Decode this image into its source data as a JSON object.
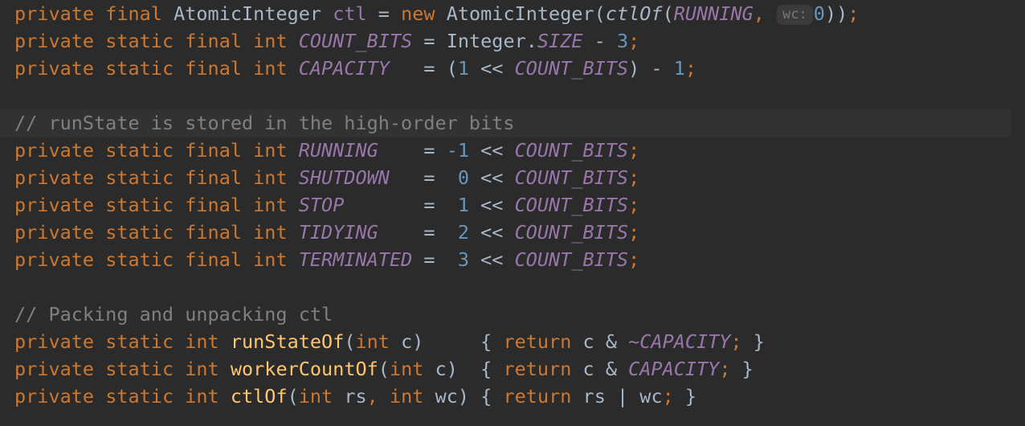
{
  "editor": {
    "language": "java",
    "theme": "darcula",
    "background_color": "#2b2b2b",
    "caret_line_color": "#323232",
    "font_size_px": 23.5,
    "line_height_px": 34,
    "colors": {
      "keyword": "#cc7832",
      "number": "#6897bb",
      "constant": "#9876aa",
      "field": "#9876aa",
      "method_declaration": "#ffc66d",
      "method_call": "#a9b7c6",
      "comment": "#808080",
      "identifier": "#a9b7c6",
      "semicolon": "#cc7832",
      "param_hint_text": "#787878",
      "param_hint_background": "#3b3b3b"
    },
    "caret_line_index": 4
  },
  "param_hints": [
    {
      "label": "wc:",
      "on_line": 1,
      "before_value": "0"
    }
  ],
  "lines": [
    {
      "n": 1,
      "caret": false,
      "text": "    private final AtomicInteger ctl = new AtomicInteger(ctlOf(RUNNING,  wc: 0));",
      "tokens": [
        {
          "t": "private",
          "c": "tok-kw"
        },
        {
          "t": " ",
          "c": "tok-punct"
        },
        {
          "t": "final",
          "c": "tok-kw"
        },
        {
          "t": " ",
          "c": "tok-punct"
        },
        {
          "t": "AtomicInteger",
          "c": "tok-type"
        },
        {
          "t": " ",
          "c": "tok-punct"
        },
        {
          "t": "ctl",
          "c": "tok-field"
        },
        {
          "t": " = ",
          "c": "tok-op"
        },
        {
          "t": "new",
          "c": "tok-kw"
        },
        {
          "t": " ",
          "c": "tok-punct"
        },
        {
          "t": "AtomicInteger",
          "c": "tok-type"
        },
        {
          "t": "(",
          "c": "tok-punct"
        },
        {
          "t": "ctlOf",
          "c": "tok-call"
        },
        {
          "t": "(",
          "c": "tok-punct"
        },
        {
          "t": "RUNNING",
          "c": "tok-const"
        },
        {
          "t": ",",
          "c": "tok-semi"
        },
        {
          "t": " ",
          "c": "tok-punct"
        },
        {
          "t": "wc:",
          "c": "param-hint"
        },
        {
          "t": "0",
          "c": "tok-num"
        },
        {
          "t": "))",
          "c": "tok-punct"
        },
        {
          "t": ";",
          "c": "tok-semi"
        }
      ]
    },
    {
      "n": 2,
      "caret": false,
      "text": "    private static final int COUNT_BITS = Integer.SIZE - 3;",
      "tokens": [
        {
          "t": "private",
          "c": "tok-kw"
        },
        {
          "t": " ",
          "c": "tok-punct"
        },
        {
          "t": "static",
          "c": "tok-kw"
        },
        {
          "t": " ",
          "c": "tok-punct"
        },
        {
          "t": "final",
          "c": "tok-kw"
        },
        {
          "t": " ",
          "c": "tok-punct"
        },
        {
          "t": "int",
          "c": "tok-kw"
        },
        {
          "t": " ",
          "c": "tok-punct"
        },
        {
          "t": "COUNT_BITS",
          "c": "tok-const"
        },
        {
          "t": " = ",
          "c": "tok-op"
        },
        {
          "t": "Integer",
          "c": "tok-type"
        },
        {
          "t": ".",
          "c": "tok-punct"
        },
        {
          "t": "SIZE",
          "c": "tok-const"
        },
        {
          "t": " - ",
          "c": "tok-op"
        },
        {
          "t": "3",
          "c": "tok-num"
        },
        {
          "t": ";",
          "c": "tok-semi"
        }
      ]
    },
    {
      "n": 3,
      "caret": false,
      "text": "    private static final int CAPACITY   = (1 << COUNT_BITS) - 1;",
      "tokens": [
        {
          "t": "private",
          "c": "tok-kw"
        },
        {
          "t": " ",
          "c": "tok-punct"
        },
        {
          "t": "static",
          "c": "tok-kw"
        },
        {
          "t": " ",
          "c": "tok-punct"
        },
        {
          "t": "final",
          "c": "tok-kw"
        },
        {
          "t": " ",
          "c": "tok-punct"
        },
        {
          "t": "int",
          "c": "tok-kw"
        },
        {
          "t": " ",
          "c": "tok-punct"
        },
        {
          "t": "CAPACITY",
          "c": "tok-const"
        },
        {
          "t": "   = ",
          "c": "tok-op"
        },
        {
          "t": "(",
          "c": "tok-punct"
        },
        {
          "t": "1",
          "c": "tok-num"
        },
        {
          "t": " << ",
          "c": "tok-op"
        },
        {
          "t": "COUNT_BITS",
          "c": "tok-const"
        },
        {
          "t": ")",
          "c": "tok-punct"
        },
        {
          "t": " - ",
          "c": "tok-op"
        },
        {
          "t": "1",
          "c": "tok-num"
        },
        {
          "t": ";",
          "c": "tok-semi"
        }
      ]
    },
    {
      "n": 4,
      "caret": false,
      "blank": true,
      "text": "",
      "tokens": []
    },
    {
      "n": 5,
      "caret": true,
      "text": "    // runState is stored in the high-order bits",
      "tokens": [
        {
          "t": "// runState is stored in the high-order bits",
          "c": "tok-comment"
        }
      ]
    },
    {
      "n": 6,
      "caret": false,
      "text": "    private static final int RUNNING    = -1 << COUNT_BITS;",
      "tokens": [
        {
          "t": "private",
          "c": "tok-kw"
        },
        {
          "t": " ",
          "c": "tok-punct"
        },
        {
          "t": "static",
          "c": "tok-kw"
        },
        {
          "t": " ",
          "c": "tok-punct"
        },
        {
          "t": "final",
          "c": "tok-kw"
        },
        {
          "t": " ",
          "c": "tok-punct"
        },
        {
          "t": "int",
          "c": "tok-kw"
        },
        {
          "t": " ",
          "c": "tok-punct"
        },
        {
          "t": "RUNNING",
          "c": "tok-const"
        },
        {
          "t": "    = ",
          "c": "tok-op"
        },
        {
          "t": "-1",
          "c": "tok-num"
        },
        {
          "t": " << ",
          "c": "tok-op"
        },
        {
          "t": "COUNT_BITS",
          "c": "tok-const"
        },
        {
          "t": ";",
          "c": "tok-semi"
        }
      ]
    },
    {
      "n": 7,
      "caret": false,
      "text": "    private static final int SHUTDOWN   =  0 << COUNT_BITS;",
      "tokens": [
        {
          "t": "private",
          "c": "tok-kw"
        },
        {
          "t": " ",
          "c": "tok-punct"
        },
        {
          "t": "static",
          "c": "tok-kw"
        },
        {
          "t": " ",
          "c": "tok-punct"
        },
        {
          "t": "final",
          "c": "tok-kw"
        },
        {
          "t": " ",
          "c": "tok-punct"
        },
        {
          "t": "int",
          "c": "tok-kw"
        },
        {
          "t": " ",
          "c": "tok-punct"
        },
        {
          "t": "SHUTDOWN",
          "c": "tok-const"
        },
        {
          "t": "   =  ",
          "c": "tok-op"
        },
        {
          "t": "0",
          "c": "tok-num"
        },
        {
          "t": " << ",
          "c": "tok-op"
        },
        {
          "t": "COUNT_BITS",
          "c": "tok-const"
        },
        {
          "t": ";",
          "c": "tok-semi"
        }
      ]
    },
    {
      "n": 8,
      "caret": false,
      "text": "    private static final int STOP       =  1 << COUNT_BITS;",
      "tokens": [
        {
          "t": "private",
          "c": "tok-kw"
        },
        {
          "t": " ",
          "c": "tok-punct"
        },
        {
          "t": "static",
          "c": "tok-kw"
        },
        {
          "t": " ",
          "c": "tok-punct"
        },
        {
          "t": "final",
          "c": "tok-kw"
        },
        {
          "t": " ",
          "c": "tok-punct"
        },
        {
          "t": "int",
          "c": "tok-kw"
        },
        {
          "t": " ",
          "c": "tok-punct"
        },
        {
          "t": "STOP",
          "c": "tok-const"
        },
        {
          "t": "       =  ",
          "c": "tok-op"
        },
        {
          "t": "1",
          "c": "tok-num"
        },
        {
          "t": " << ",
          "c": "tok-op"
        },
        {
          "t": "COUNT_BITS",
          "c": "tok-const"
        },
        {
          "t": ";",
          "c": "tok-semi"
        }
      ]
    },
    {
      "n": 9,
      "caret": false,
      "text": "    private static final int TIDYING    =  2 << COUNT_BITS;",
      "tokens": [
        {
          "t": "private",
          "c": "tok-kw"
        },
        {
          "t": " ",
          "c": "tok-punct"
        },
        {
          "t": "static",
          "c": "tok-kw"
        },
        {
          "t": " ",
          "c": "tok-punct"
        },
        {
          "t": "final",
          "c": "tok-kw"
        },
        {
          "t": " ",
          "c": "tok-punct"
        },
        {
          "t": "int",
          "c": "tok-kw"
        },
        {
          "t": " ",
          "c": "tok-punct"
        },
        {
          "t": "TIDYING",
          "c": "tok-const"
        },
        {
          "t": "    =  ",
          "c": "tok-op"
        },
        {
          "t": "2",
          "c": "tok-num"
        },
        {
          "t": " << ",
          "c": "tok-op"
        },
        {
          "t": "COUNT_BITS",
          "c": "tok-const"
        },
        {
          "t": ";",
          "c": "tok-semi"
        }
      ]
    },
    {
      "n": 10,
      "caret": false,
      "text": "    private static final int TERMINATED =  3 << COUNT_BITS;",
      "tokens": [
        {
          "t": "private",
          "c": "tok-kw"
        },
        {
          "t": " ",
          "c": "tok-punct"
        },
        {
          "t": "static",
          "c": "tok-kw"
        },
        {
          "t": " ",
          "c": "tok-punct"
        },
        {
          "t": "final",
          "c": "tok-kw"
        },
        {
          "t": " ",
          "c": "tok-punct"
        },
        {
          "t": "int",
          "c": "tok-kw"
        },
        {
          "t": " ",
          "c": "tok-punct"
        },
        {
          "t": "TERMINATED",
          "c": "tok-const"
        },
        {
          "t": " =  ",
          "c": "tok-op"
        },
        {
          "t": "3",
          "c": "tok-num"
        },
        {
          "t": " << ",
          "c": "tok-op"
        },
        {
          "t": "COUNT_BITS",
          "c": "tok-const"
        },
        {
          "t": ";",
          "c": "tok-semi"
        }
      ]
    },
    {
      "n": 11,
      "caret": false,
      "blank": true,
      "text": "",
      "tokens": []
    },
    {
      "n": 12,
      "caret": false,
      "text": "    // Packing and unpacking ctl",
      "tokens": [
        {
          "t": "// Packing and unpacking ctl",
          "c": "tok-comment"
        }
      ]
    },
    {
      "n": 13,
      "caret": false,
      "text": "    private static int runStateOf(int c)     { return c & ~CAPACITY; }",
      "tokens": [
        {
          "t": "private",
          "c": "tok-kw"
        },
        {
          "t": " ",
          "c": "tok-punct"
        },
        {
          "t": "static",
          "c": "tok-kw"
        },
        {
          "t": " ",
          "c": "tok-punct"
        },
        {
          "t": "int",
          "c": "tok-kw"
        },
        {
          "t": " ",
          "c": "tok-punct"
        },
        {
          "t": "runStateOf",
          "c": "tok-method"
        },
        {
          "t": "(",
          "c": "tok-punct"
        },
        {
          "t": "int",
          "c": "tok-kw"
        },
        {
          "t": " ",
          "c": "tok-punct"
        },
        {
          "t": "c",
          "c": "tok-ident"
        },
        {
          "t": ")",
          "c": "tok-punct"
        },
        {
          "t": "     { ",
          "c": "tok-punct"
        },
        {
          "t": "return",
          "c": "tok-kw"
        },
        {
          "t": " ",
          "c": "tok-punct"
        },
        {
          "t": "c",
          "c": "tok-ident"
        },
        {
          "t": " & ",
          "c": "tok-op"
        },
        {
          "t": "~CAPACITY",
          "c": "tok-const"
        },
        {
          "t": ";",
          "c": "tok-semi"
        },
        {
          "t": " }",
          "c": "tok-punct"
        }
      ]
    },
    {
      "n": 14,
      "caret": false,
      "text": "    private static int workerCountOf(int c)  { return c & CAPACITY; }",
      "tokens": [
        {
          "t": "private",
          "c": "tok-kw"
        },
        {
          "t": " ",
          "c": "tok-punct"
        },
        {
          "t": "static",
          "c": "tok-kw"
        },
        {
          "t": " ",
          "c": "tok-punct"
        },
        {
          "t": "int",
          "c": "tok-kw"
        },
        {
          "t": " ",
          "c": "tok-punct"
        },
        {
          "t": "workerCountOf",
          "c": "tok-method"
        },
        {
          "t": "(",
          "c": "tok-punct"
        },
        {
          "t": "int",
          "c": "tok-kw"
        },
        {
          "t": " ",
          "c": "tok-punct"
        },
        {
          "t": "c",
          "c": "tok-ident"
        },
        {
          "t": ")",
          "c": "tok-punct"
        },
        {
          "t": "  { ",
          "c": "tok-punct"
        },
        {
          "t": "return",
          "c": "tok-kw"
        },
        {
          "t": " ",
          "c": "tok-punct"
        },
        {
          "t": "c",
          "c": "tok-ident"
        },
        {
          "t": " & ",
          "c": "tok-op"
        },
        {
          "t": "CAPACITY",
          "c": "tok-const"
        },
        {
          "t": ";",
          "c": "tok-semi"
        },
        {
          "t": " }",
          "c": "tok-punct"
        }
      ]
    },
    {
      "n": 15,
      "caret": false,
      "text": "    private static int ctlOf(int rs, int wc) { return rs | wc; }",
      "tokens": [
        {
          "t": "private",
          "c": "tok-kw"
        },
        {
          "t": " ",
          "c": "tok-punct"
        },
        {
          "t": "static",
          "c": "tok-kw"
        },
        {
          "t": " ",
          "c": "tok-punct"
        },
        {
          "t": "int",
          "c": "tok-kw"
        },
        {
          "t": " ",
          "c": "tok-punct"
        },
        {
          "t": "ctlOf",
          "c": "tok-method"
        },
        {
          "t": "(",
          "c": "tok-punct"
        },
        {
          "t": "int",
          "c": "tok-kw"
        },
        {
          "t": " ",
          "c": "tok-punct"
        },
        {
          "t": "rs",
          "c": "tok-ident"
        },
        {
          "t": ",",
          "c": "tok-semi"
        },
        {
          "t": " ",
          "c": "tok-punct"
        },
        {
          "t": "int",
          "c": "tok-kw"
        },
        {
          "t": " ",
          "c": "tok-punct"
        },
        {
          "t": "wc",
          "c": "tok-ident"
        },
        {
          "t": ")",
          "c": "tok-punct"
        },
        {
          "t": " { ",
          "c": "tok-punct"
        },
        {
          "t": "return",
          "c": "tok-kw"
        },
        {
          "t": " ",
          "c": "tok-punct"
        },
        {
          "t": "rs",
          "c": "tok-ident"
        },
        {
          "t": " | ",
          "c": "tok-op"
        },
        {
          "t": "wc",
          "c": "tok-ident"
        },
        {
          "t": ";",
          "c": "tok-semi"
        },
        {
          "t": " }",
          "c": "tok-punct"
        }
      ]
    }
  ]
}
